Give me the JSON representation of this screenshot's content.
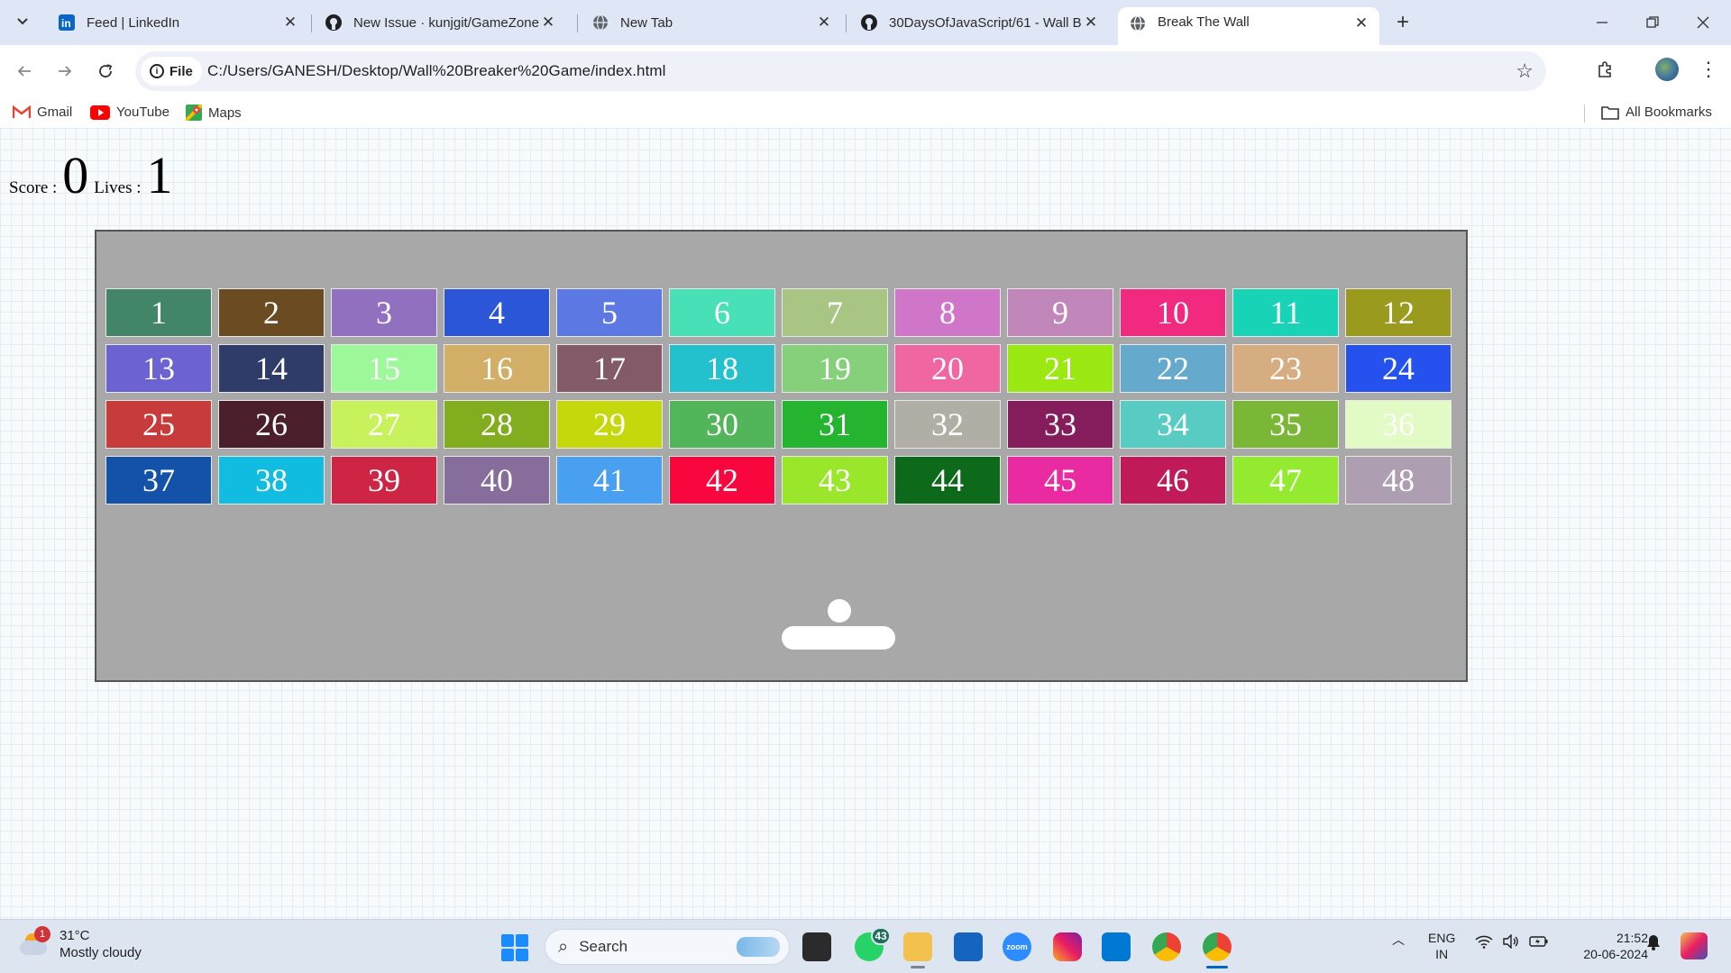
{
  "browser": {
    "tabs": [
      {
        "title": "Feed | LinkedIn",
        "icon": "linkedin-icon",
        "active": false
      },
      {
        "title": "New Issue · kunjgit/GameZone",
        "icon": "github-icon",
        "active": false
      },
      {
        "title": "New Tab",
        "icon": "globe-icon",
        "active": false
      },
      {
        "title": "30DaysOfJavaScript/61 - Wall B",
        "icon": "github-icon",
        "active": false
      },
      {
        "title": "Break The Wall",
        "icon": "globe-icon",
        "active": true
      }
    ],
    "file_chip": "File",
    "url": "C:/Users/GANESH/Desktop/Wall%20Breaker%20Game/index.html",
    "bookmarks": [
      {
        "label": "Gmail",
        "icon": "gmail-icon"
      },
      {
        "label": "YouTube",
        "icon": "youtube-icon"
      },
      {
        "label": "Maps",
        "icon": "maps-icon"
      }
    ],
    "all_bookmarks": "All Bookmarks"
  },
  "game": {
    "score_label": "Score :",
    "score": "0",
    "lives_label": "Lives :",
    "lives": "1",
    "board_color": "#a8a8a8",
    "bricks": [
      {
        "label": "1",
        "color": "#438568"
      },
      {
        "label": "2",
        "color": "#6b4c22"
      },
      {
        "label": "3",
        "color": "#9270c0"
      },
      {
        "label": "4",
        "color": "#2c56d8"
      },
      {
        "label": "5",
        "color": "#5b78e3"
      },
      {
        "label": "6",
        "color": "#48e0b6"
      },
      {
        "label": "7",
        "color": "#a9c583"
      },
      {
        "label": "8",
        "color": "#cf76c9"
      },
      {
        "label": "9",
        "color": "#c187bb"
      },
      {
        "label": "10",
        "color": "#f12a80"
      },
      {
        "label": "11",
        "color": "#18d3b5"
      },
      {
        "label": "12",
        "color": "#999a1e"
      },
      {
        "label": "13",
        "color": "#6d62d2"
      },
      {
        "label": "14",
        "color": "#2f3b68"
      },
      {
        "label": "15",
        "color": "#9cf899"
      },
      {
        "label": "16",
        "color": "#d2ae66"
      },
      {
        "label": "17",
        "color": "#835a68"
      },
      {
        "label": "18",
        "color": "#23c0cd"
      },
      {
        "label": "19",
        "color": "#86cf7b"
      },
      {
        "label": "20",
        "color": "#f066a1"
      },
      {
        "label": "21",
        "color": "#9be812"
      },
      {
        "label": "22",
        "color": "#65a9cd"
      },
      {
        "label": "23",
        "color": "#d5ad81"
      },
      {
        "label": "24",
        "color": "#2552ee"
      },
      {
        "label": "25",
        "color": "#c73c3b"
      },
      {
        "label": "26",
        "color": "#4a1e2a"
      },
      {
        "label": "27",
        "color": "#c8f25b"
      },
      {
        "label": "28",
        "color": "#82ad1e"
      },
      {
        "label": "29",
        "color": "#c4d80b"
      },
      {
        "label": "30",
        "color": "#52b559"
      },
      {
        "label": "31",
        "color": "#24b42f"
      },
      {
        "label": "32",
        "color": "#b1aea5"
      },
      {
        "label": "33",
        "color": "#851d5c"
      },
      {
        "label": "34",
        "color": "#58cbc2"
      },
      {
        "label": "35",
        "color": "#7bb736"
      },
      {
        "label": "36",
        "color": "#e2fac4"
      },
      {
        "label": "37",
        "color": "#1452aa"
      },
      {
        "label": "38",
        "color": "#10bce0"
      },
      {
        "label": "39",
        "color": "#cf2544"
      },
      {
        "label": "40",
        "color": "#866d9c"
      },
      {
        "label": "41",
        "color": "#4aa0f0"
      },
      {
        "label": "42",
        "color": "#f9063e"
      },
      {
        "label": "43",
        "color": "#9ae62b"
      },
      {
        "label": "44",
        "color": "#0c6a1a"
      },
      {
        "label": "45",
        "color": "#ea2aa1"
      },
      {
        "label": "46",
        "color": "#c11a59"
      },
      {
        "label": "47",
        "color": "#93ea2f"
      },
      {
        "label": "48",
        "color": "#ae9eb2"
      }
    ]
  },
  "taskbar": {
    "weather_temp": "31°C",
    "weather_desc": "Mostly cloudy",
    "weather_badge": "1",
    "search_placeholder": "Search",
    "whatsapp_badge": "43",
    "lang_top": "ENG",
    "lang_bottom": "IN",
    "time": "21:52",
    "date": "20-06-2024"
  }
}
